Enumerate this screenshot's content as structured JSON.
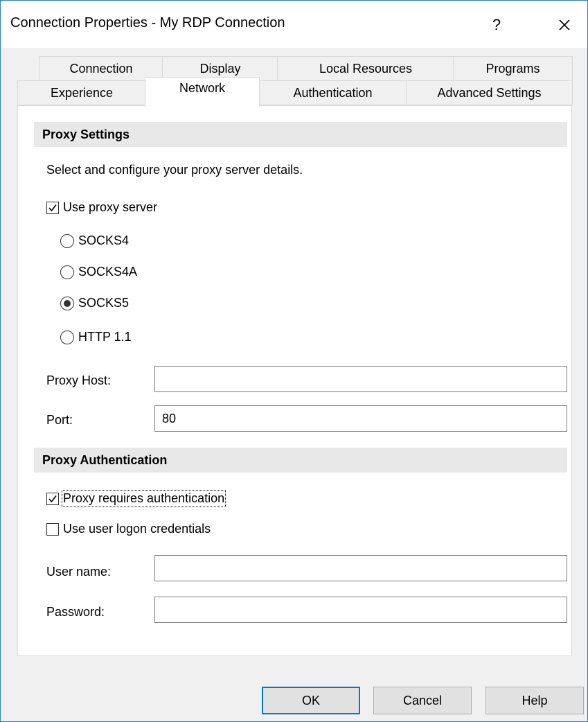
{
  "window": {
    "title": "Connection Properties - My RDP Connection",
    "help_glyph": "?",
    "close_icon": "close-icon"
  },
  "tabs": {
    "row1": [
      "Connection",
      "Display",
      "Local Resources",
      "Programs"
    ],
    "row2": [
      "Experience",
      "Network",
      "Authentication",
      "Advanced Settings"
    ],
    "active": "Network"
  },
  "proxy_settings": {
    "header": "Proxy Settings",
    "description": "Select and configure your proxy server details.",
    "use_proxy": {
      "label": "Use proxy server",
      "checked": true
    },
    "protocols": [
      {
        "label": "SOCKS4",
        "selected": false
      },
      {
        "label": "SOCKS4A",
        "selected": false
      },
      {
        "label": "SOCKS5",
        "selected": true
      },
      {
        "label": "HTTP 1.1",
        "selected": false
      }
    ],
    "host": {
      "label": "Proxy Host:",
      "value": ""
    },
    "port": {
      "label": "Port:",
      "value": "80"
    }
  },
  "proxy_auth": {
    "header": "Proxy Authentication",
    "requires_auth": {
      "label": "Proxy requires authentication",
      "checked": true
    },
    "use_logon": {
      "label": "Use user logon credentials",
      "checked": false
    },
    "username": {
      "label": "User name:",
      "value": ""
    },
    "password": {
      "label": "Password:",
      "value": ""
    }
  },
  "buttons": {
    "ok": "OK",
    "cancel": "Cancel",
    "help": "Help"
  }
}
